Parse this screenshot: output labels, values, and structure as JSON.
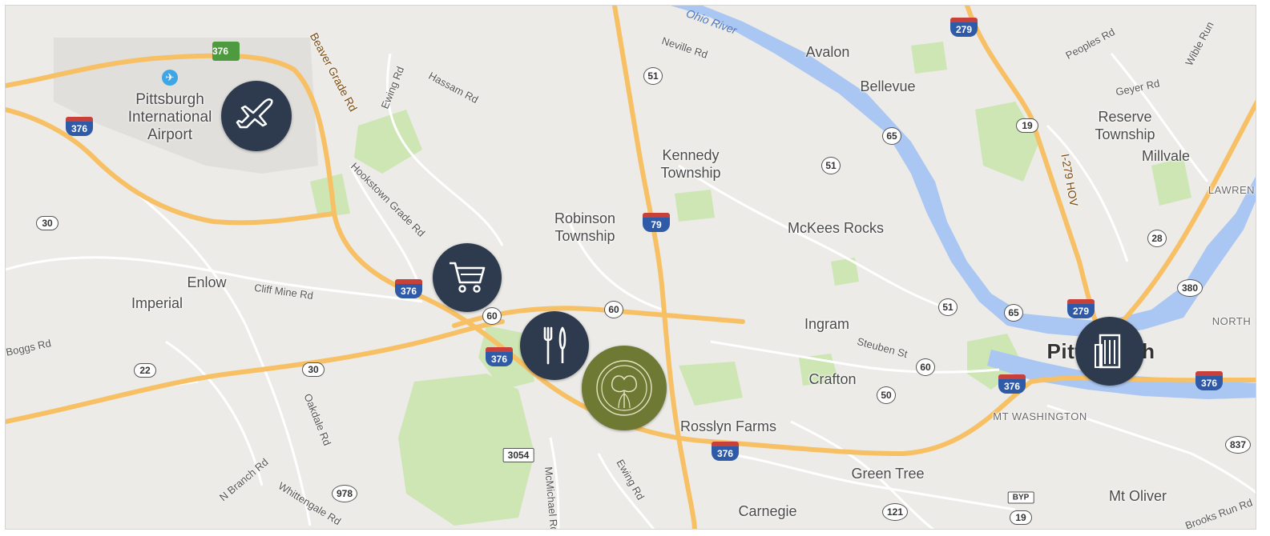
{
  "map": {
    "colors": {
      "land": "#ecebe7",
      "park": "#cde6b4",
      "water": "#aac6f2",
      "highway": "#f7c064",
      "road": "#ffffff",
      "marker": "#2e3b4e",
      "home_marker": "#6e7a33"
    },
    "places": {
      "airport": "Pittsburgh\nInternational\nAirport",
      "robinson": "Robinson\nTownship",
      "kennedy": "Kennedy\nTownship",
      "avalon": "Avalon",
      "bellevue": "Bellevue",
      "reserve": "Reserve\nTownship",
      "millvale": "Millvale",
      "mckees_rocks": "McKees Rocks",
      "enlow": "Enlow",
      "imperial": "Imperial",
      "ingram": "Ingram",
      "crafton": "Crafton",
      "rosslyn": "Rosslyn Farms",
      "green_tree": "Green Tree",
      "carnegie": "Carnegie",
      "pittsburgh": "Pittsburgh",
      "mt_oliver": "Mt Oliver",
      "mt_washington": "MT WASHINGTON",
      "lawrenceville": "LAWREN",
      "north": "NORTH"
    },
    "roads": {
      "beaver_grade": "Beaver Grade Rd",
      "hookstown": "Hookstown Grade Rd",
      "ewing_top": "Ewing Rd",
      "hassam": "Hassam Rd",
      "cliff_mine": "Cliff Mine Rd",
      "boggs": "Boggs Rd",
      "oakdale": "Oakdale Rd",
      "n_branch": "N Branch Rd",
      "whittengale": "Whittengale Rd",
      "mcmichael": "McMichael Rd",
      "ewing_bottom": "Ewing Rd",
      "neville": "Neville Rd",
      "steuben": "Steuben St",
      "peoples": "Peoples Rd",
      "geyer": "Geyer Rd",
      "i279_hov": "I-279 HOV",
      "wible": "Wible Run",
      "brooks": "Brooks Run Rd",
      "ohio_river": "Ohio River"
    },
    "shields": {
      "i376_a": "376",
      "i376_b": "376",
      "i376_c": "376",
      "i376_d": "376",
      "i376_e": "376",
      "i376_f": "376",
      "i376_g": "376",
      "i79": "79",
      "i279_a": "279",
      "i279_b": "279",
      "us30_a": "30",
      "us30_b": "30",
      "us22": "22",
      "us19_a": "19",
      "us19_b": "19",
      "pa51_a": "51",
      "pa51_b": "51",
      "pa51_c": "51",
      "pa65_a": "65",
      "pa65_b": "65",
      "pa60_a": "60",
      "pa60_b": "60",
      "pa60_c": "60",
      "pa50": "50",
      "pa121": "121",
      "pa28": "28",
      "pa380": "380",
      "pa837": "837",
      "pa978": "978",
      "sr3054": "3054",
      "byp": "BYP"
    },
    "markers": {
      "airport": "airport-icon",
      "shopping": "shopping-cart-icon",
      "dining": "fork-knife-icon",
      "community": "tree-logo-icon",
      "city": "office-building-icon"
    }
  }
}
